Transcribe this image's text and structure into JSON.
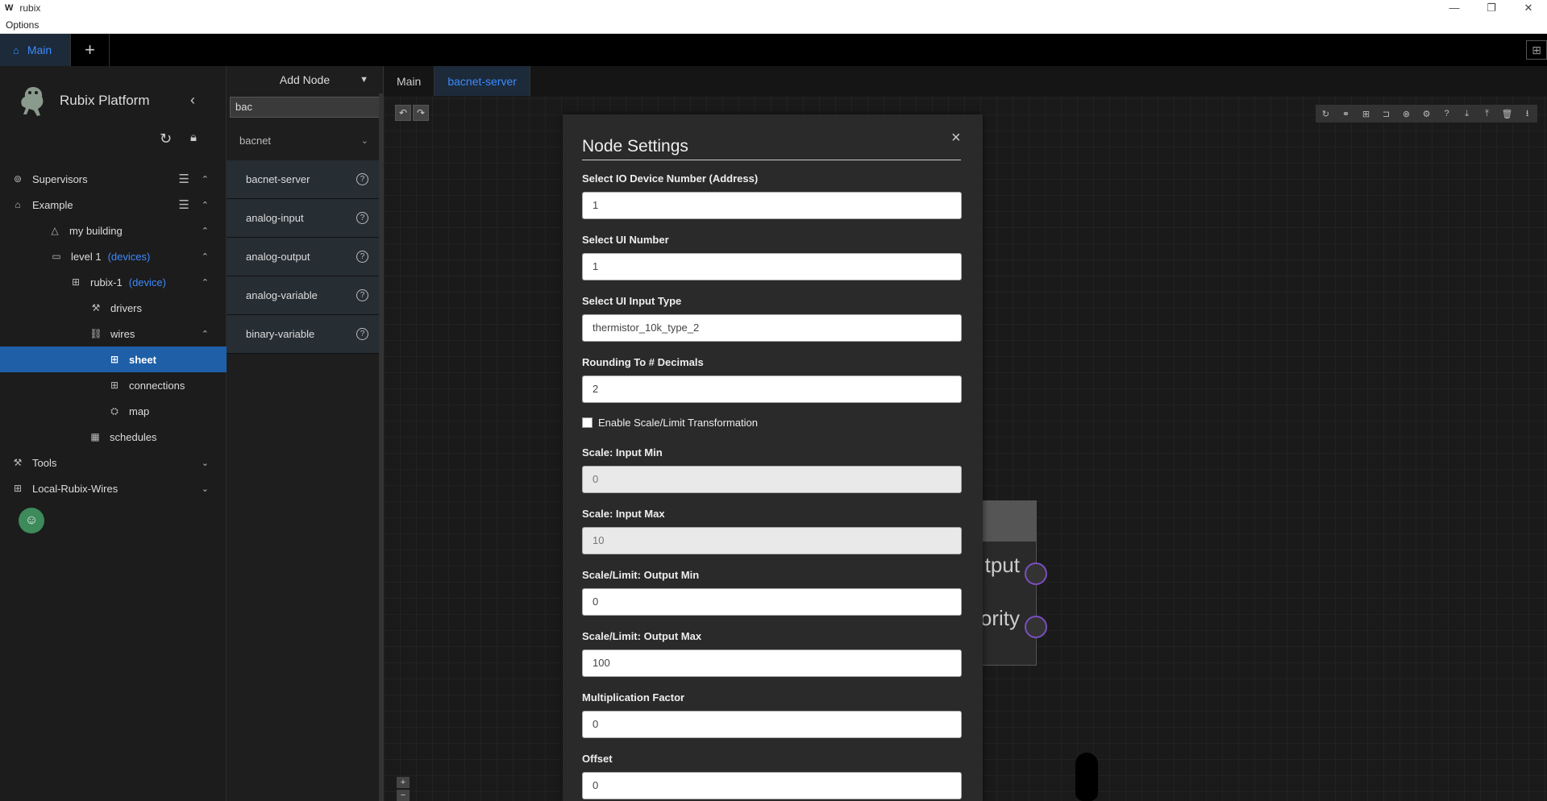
{
  "window": {
    "app_icon": "W",
    "title": "rubix",
    "menu": [
      "Options"
    ],
    "controls": [
      "—",
      "❐",
      "✕"
    ]
  },
  "tabs": {
    "main_label": "Main",
    "add_label": "+",
    "layout_icon": "layout-icon"
  },
  "sidebar": {
    "brand": "Rubix Platform",
    "items": [
      {
        "label": "Supervisors",
        "icon": "supervisors-icon",
        "glyph": "⊚"
      },
      {
        "label": "Example",
        "icon": "home-icon",
        "glyph": "⌂"
      },
      {
        "label": "my building",
        "icon": "building-icon",
        "glyph": "△"
      },
      {
        "label": "level 1",
        "sub": "(devices)",
        "icon": "laptop-icon",
        "glyph": "▭"
      },
      {
        "label": "rubix-1",
        "sub": "(device)",
        "icon": "device-icon",
        "glyph": "⊞"
      },
      {
        "label": "drivers",
        "icon": "wrench-icon",
        "glyph": "⚒"
      },
      {
        "label": "wires",
        "icon": "wires-icon",
        "glyph": "⛓"
      },
      {
        "label": "sheet",
        "icon": "sheet-icon",
        "glyph": "⊞"
      },
      {
        "label": "connections",
        "icon": "connections-icon",
        "glyph": "⊞"
      },
      {
        "label": "map",
        "icon": "map-icon",
        "glyph": "⛭"
      },
      {
        "label": "schedules",
        "icon": "schedules-icon",
        "glyph": "▦"
      },
      {
        "label": "Tools",
        "icon": "tools-icon",
        "glyph": "⚒"
      },
      {
        "label": "Local-Rubix-Wires",
        "icon": "network-icon",
        "glyph": "⊞"
      }
    ]
  },
  "node_panel": {
    "title": "Add Node",
    "search_value": "bac",
    "group": "bacnet",
    "nodes": [
      "bacnet-server",
      "analog-input",
      "analog-output",
      "analog-variable",
      "binary-variable"
    ]
  },
  "canvas": {
    "tabs": [
      "Main",
      "bacnet-server"
    ],
    "node_labels": [
      "tput",
      "ority"
    ]
  },
  "dialog": {
    "title": "Node Settings",
    "close": "×",
    "fields": [
      {
        "label": "Select IO Device Number (Address)",
        "value": "1"
      },
      {
        "label": "Select UI Number",
        "value": "1"
      },
      {
        "label": "Select UI Input Type",
        "value": "thermistor_10k_type_2"
      },
      {
        "label": "Rounding To # Decimals",
        "value": "2"
      },
      {
        "label": "Scale: Input Min",
        "value": "0"
      },
      {
        "label": "Scale: Input Max",
        "value": "10"
      },
      {
        "label": "Scale/Limit: Output Min",
        "value": "0"
      },
      {
        "label": "Scale/Limit: Output Max",
        "value": "100"
      },
      {
        "label": "Multiplication Factor",
        "value": "0"
      },
      {
        "label": "Offset",
        "value": "0"
      }
    ],
    "checkbox_label": "Enable Scale/Limit Transformation"
  },
  "colors": {
    "accent": "#3d8bfd",
    "selected": "#1e5fa8",
    "port": "#7a4fc0"
  }
}
